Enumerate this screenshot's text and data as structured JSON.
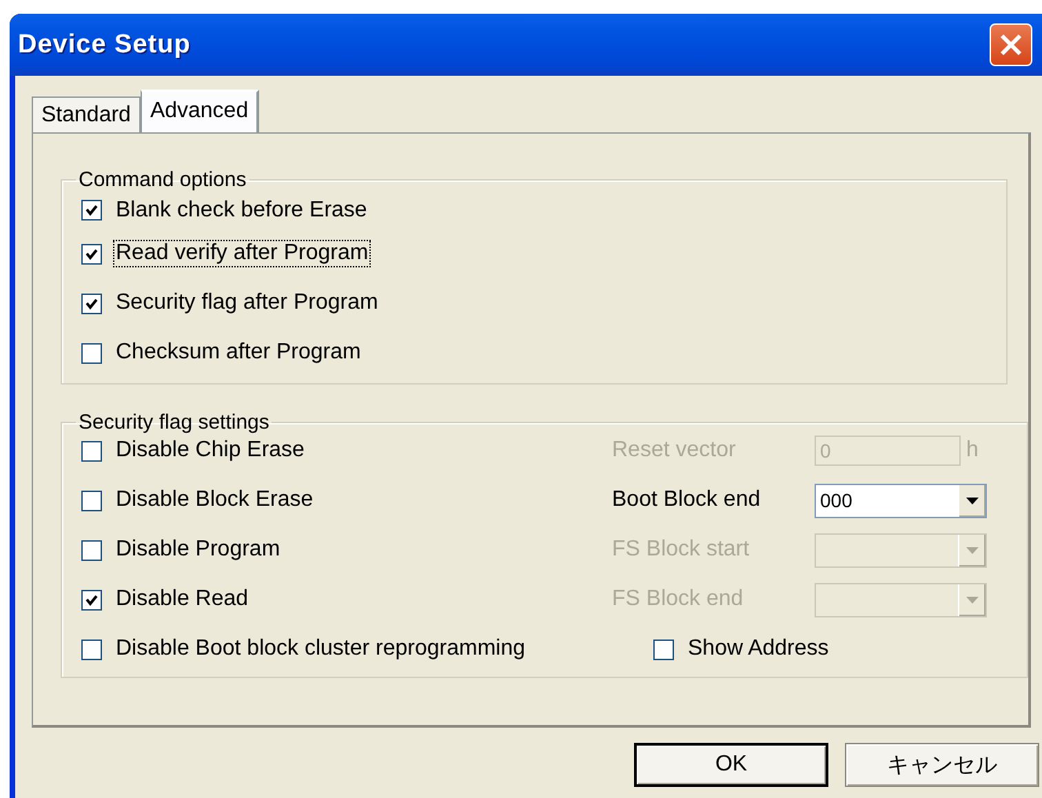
{
  "window": {
    "title": "Device Setup"
  },
  "tabs": [
    {
      "label": "Standard",
      "selected": false
    },
    {
      "label": "Advanced",
      "selected": true
    }
  ],
  "command_options": {
    "title": "Command options",
    "options": [
      {
        "label": "Blank check before Erase",
        "checked": true,
        "focused": false
      },
      {
        "label": "Read verify after Program",
        "checked": true,
        "focused": true
      },
      {
        "label": "Security flag after Program",
        "checked": true,
        "focused": false
      },
      {
        "label": "Checksum after Program",
        "checked": false,
        "focused": false
      }
    ]
  },
  "security_flag_settings": {
    "title": "Security flag settings",
    "flags": [
      {
        "label": "Disable Chip Erase",
        "checked": false
      },
      {
        "label": "Disable Block Erase",
        "checked": false
      },
      {
        "label": "Disable Program",
        "checked": false
      },
      {
        "label": "Disable Read",
        "checked": true
      },
      {
        "label": "Disable Boot block cluster reprogramming",
        "checked": false
      }
    ],
    "fields": [
      {
        "kind": "text",
        "label": "Reset vector",
        "value": "0",
        "suffix": "h",
        "disabled": true
      },
      {
        "kind": "dropdown",
        "label": "Boot Block end",
        "value": "000",
        "disabled": false
      },
      {
        "kind": "dropdown",
        "label": "FS Block start",
        "disabled": true
      },
      {
        "kind": "dropdown",
        "label": "FS Block end",
        "disabled": true
      }
    ],
    "show_address": {
      "label": "Show Address",
      "checked": false
    }
  },
  "buttons": [
    {
      "label": "OK",
      "default": true
    },
    {
      "label": "キャンセル",
      "default": false
    }
  ]
}
